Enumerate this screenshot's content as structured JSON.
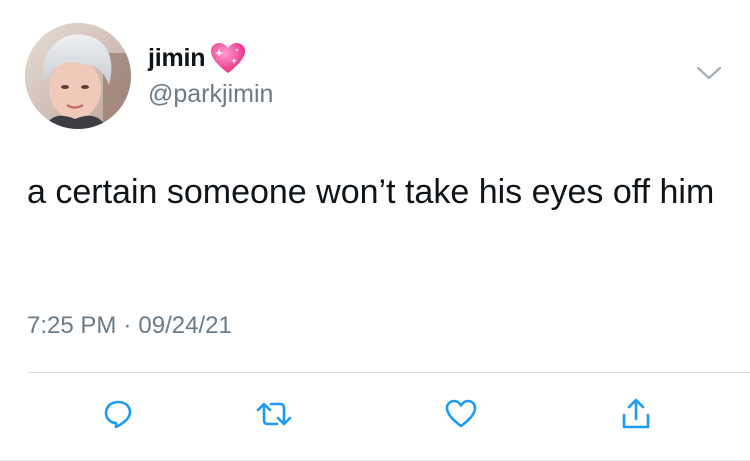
{
  "author": {
    "display_name": "jimin",
    "handle": "@parkjimin",
    "name_emoji": "sparkling-heart-icon"
  },
  "tweet": {
    "text": "a certain someone won’t take his eyes off him",
    "time": "7:25 PM",
    "separator": "·",
    "date": "09/24/21"
  },
  "actions": [
    "reply-icon",
    "retweet-icon",
    "like-icon",
    "share-icon"
  ],
  "colors": {
    "text": "#0f1419",
    "secondary": "#6b7b88",
    "icon": "#1d9bf0",
    "divider": "#d8dee2",
    "heart_pink": "#f43f9a"
  }
}
